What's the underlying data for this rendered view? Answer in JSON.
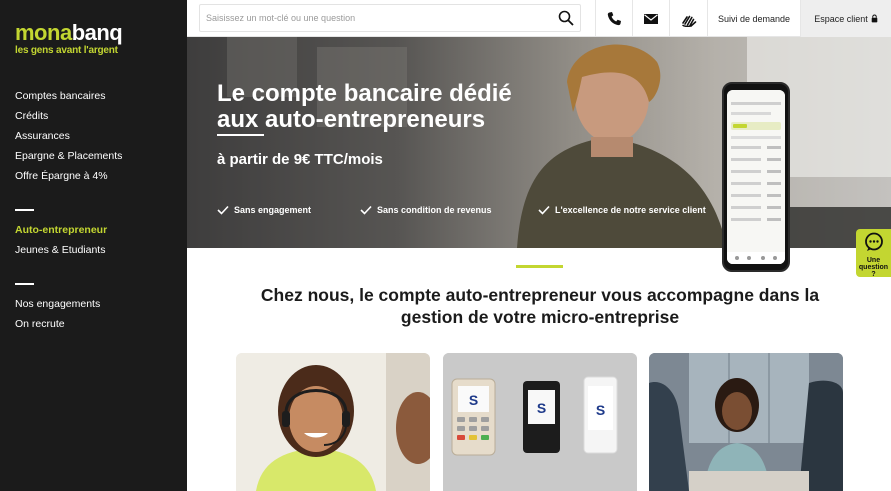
{
  "brand": {
    "name_part1": "mona",
    "name_part2": "banq",
    "tagline": "les gens avant l'argent",
    "accent": "#c3d631"
  },
  "sidebar": {
    "group1": [
      {
        "label": "Comptes bancaires"
      },
      {
        "label": "Crédits"
      },
      {
        "label": "Assurances"
      },
      {
        "label": "Epargne & Placements"
      },
      {
        "label": "Offre Épargne à 4%"
      }
    ],
    "group2": [
      {
        "label": "Auto-entrepreneur",
        "active": true
      },
      {
        "label": "Jeunes & Etudiants"
      }
    ],
    "group3": [
      {
        "label": "Nos engagements"
      },
      {
        "label": "On recrute"
      }
    ]
  },
  "topbar": {
    "search_placeholder": "Saisissez un mot-clé ou une question",
    "icons": [
      "phone-icon",
      "mail-icon",
      "sign-language-icon"
    ],
    "request_label": "Suivi de demande",
    "client_label": "Espace client"
  },
  "hero": {
    "title": "Le compte bancaire dédié aux auto-entrepreneurs",
    "price": "à partir de 9€ TTC/mois",
    "features": [
      "Sans engagement",
      "Sans condition de revenus",
      "L'excellence de notre service client"
    ]
  },
  "help": {
    "label_line1": "Une",
    "label_line2": "question",
    "label_line3": "?"
  },
  "section": {
    "title": "Chez nous, le compte auto-entrepreneur vous accompagne dans la gestion de votre micro-entreprise"
  }
}
